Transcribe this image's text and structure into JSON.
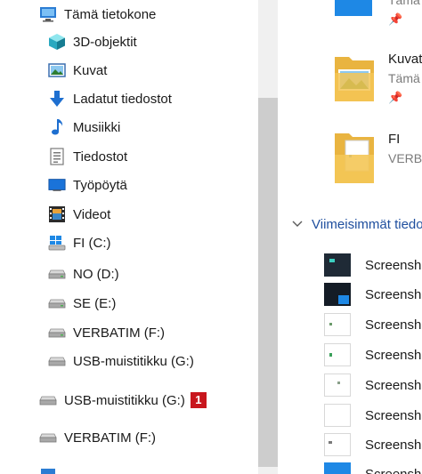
{
  "nav": {
    "items": [
      {
        "label": "Tämä tietokone",
        "icon": "computer-icon"
      },
      {
        "label": "3D-objektit",
        "icon": "cube-3d-icon"
      },
      {
        "label": "Kuvat",
        "icon": "pictures-icon"
      },
      {
        "label": "Ladatut tiedostot",
        "icon": "download-arrow-icon"
      },
      {
        "label": "Musiikki",
        "icon": "music-note-icon"
      },
      {
        "label": "Tiedostot",
        "icon": "documents-icon"
      },
      {
        "label": "Työpöytä",
        "icon": "desktop-icon"
      },
      {
        "label": "Videot",
        "icon": "film-strip-icon"
      },
      {
        "label": "FI (C:)",
        "icon": "windows-drive-icon"
      },
      {
        "label": "NO (D:)",
        "icon": "drive-icon"
      },
      {
        "label": "SE (E:)",
        "icon": "drive-icon"
      },
      {
        "label": "VERBATIM (F:)",
        "icon": "drive-icon"
      },
      {
        "label": "USB-muistitikku (G:)",
        "icon": "usb-drive-icon"
      }
    ],
    "root_items": [
      {
        "label": "USB-muistitikku (G:)",
        "icon": "usb-drive-icon",
        "badge": "1"
      },
      {
        "label": "VERBATIM (F:)",
        "icon": "usb-drive-icon"
      }
    ]
  },
  "content": {
    "top_partial_location": "Tämä",
    "folders": [
      {
        "name": "Kuvat",
        "location": "Tämä",
        "pinned": true
      },
      {
        "name": "FI",
        "location": "VERB",
        "pinned": false
      }
    ],
    "recent_section_title": "Viimeisimmät tiedostot",
    "recent_files": [
      {
        "name": "Screenshot"
      },
      {
        "name": "Screenshot"
      },
      {
        "name": "Screenshot"
      },
      {
        "name": "Screenshot"
      },
      {
        "name": "Screenshot"
      },
      {
        "name": "Screenshot"
      },
      {
        "name": "Screenshot"
      },
      {
        "name": "Screenshot"
      }
    ]
  },
  "colors": {
    "accent_blue": "#1e4e9e",
    "badge_red": "#c8161d",
    "folder_yellow": "#f4c656"
  }
}
